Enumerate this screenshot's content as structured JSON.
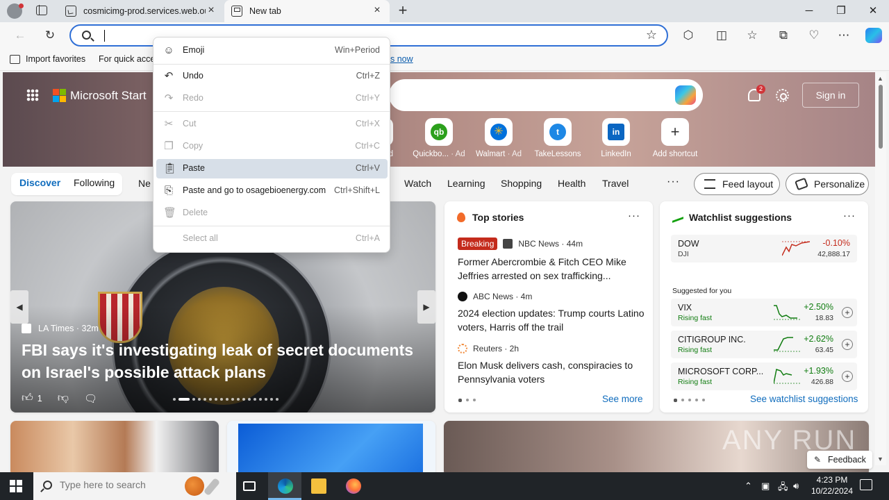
{
  "browser": {
    "tabs": [
      {
        "title": "cosmicimg-prod.services.web.ou",
        "active": false
      },
      {
        "title": "New tab",
        "active": true
      }
    ],
    "address_value": "",
    "favorites_bar": {
      "import": "Import favorites",
      "partial_text": "For quick acce",
      "link_partial": "s now"
    }
  },
  "context_menu": {
    "items": [
      {
        "label": "Emoji",
        "shortcut": "Win+Period",
        "enabled": true,
        "icon": "emoji-icon"
      },
      {
        "label": "Undo",
        "shortcut": "Ctrl+Z",
        "enabled": true,
        "icon": "undo-icon"
      },
      {
        "label": "Redo",
        "shortcut": "Ctrl+Y",
        "enabled": false,
        "icon": "redo-icon"
      },
      {
        "label": "Cut",
        "shortcut": "Ctrl+X",
        "enabled": false,
        "icon": "cut-icon"
      },
      {
        "label": "Copy",
        "shortcut": "Ctrl+C",
        "enabled": false,
        "icon": "copy-icon"
      },
      {
        "label": "Paste",
        "shortcut": "Ctrl+V",
        "enabled": true,
        "highlighted": true,
        "icon": "paste-icon"
      },
      {
        "label": "Paste and go to osagebioenergy.com",
        "shortcut": "Ctrl+Shift+L",
        "enabled": true,
        "icon": "paste-go-icon"
      },
      {
        "label": "Delete",
        "shortcut": "",
        "enabled": false,
        "icon": "delete-icon"
      },
      {
        "label": "Select all",
        "shortcut": "Ctrl+A",
        "enabled": false,
        "icon": ""
      }
    ]
  },
  "start_page": {
    "brand": "Microsoft Start",
    "notification_count": "2",
    "signin": "Sign in",
    "shortcuts": [
      {
        "label": "Quickbo...",
        "ad": "· Ad",
        "color": "#2ca01c",
        "glyph": "qb"
      },
      {
        "label": "Walmart",
        "ad": "· Ad",
        "color": "#0071dc",
        "glyph": "✳"
      },
      {
        "label": "TakeLessons",
        "ad": "",
        "color": "#1e88e5",
        "glyph": "t"
      },
      {
        "label": "LinkedIn",
        "ad": "",
        "color": "#0a66c2",
        "glyph": "in"
      },
      {
        "label": "Add shortcut",
        "ad": "",
        "color": "",
        "glyph": "+"
      }
    ],
    "shortcut_partial_ad": "d",
    "nav": {
      "discover": "Discover",
      "following": "Following",
      "partial": "Ne",
      "links": [
        "Watch",
        "Learning",
        "Shopping",
        "Health",
        "Travel"
      ],
      "more": "···",
      "feed_layout": "Feed layout",
      "personalize": "Personalize"
    },
    "hero": {
      "source": "LA Times · 32m",
      "title": "FBI says it's investigating leak of secret documents on Israel's possible attack plans",
      "likes": "1"
    },
    "top_stories": {
      "heading": "Top stories",
      "stories": [
        {
          "badge": "Breaking",
          "source": "NBC News · 44m",
          "title": "Former Abercrombie & Fitch CEO Mike Jeffries arrested on sex trafficking..."
        },
        {
          "badge": "",
          "source": "ABC News · 4m",
          "title": "2024 election updates: Trump courts Latino voters, Harris off the trail"
        },
        {
          "badge": "",
          "source": "Reuters · 2h",
          "title": "Elon Musk delivers cash, conspiracies to Pennsylvania voters"
        }
      ],
      "see_more": "See more"
    },
    "watchlist": {
      "heading": "Watchlist suggestions",
      "dow": {
        "symbol": "DOW",
        "sub": "DJI",
        "change": "-0.10%",
        "price": "42,888.17"
      },
      "suggested_label": "Suggested for you",
      "suggested": [
        {
          "symbol": "VIX",
          "sub": "Rising fast",
          "change": "+2.50%",
          "price": "18.83"
        },
        {
          "symbol": "CITIGROUP INC.",
          "sub": "Rising fast",
          "change": "+2.62%",
          "price": "63.45"
        },
        {
          "symbol": "MICROSOFT CORP...",
          "sub": "Rising fast",
          "change": "+1.93%",
          "price": "426.88"
        }
      ],
      "see_all": "See watchlist suggestions"
    },
    "feedback": "Feedback",
    "watermark": "ANY RUN"
  },
  "taskbar": {
    "search_placeholder": "Type here to search",
    "time": "4:23 PM",
    "date": "10/22/2024"
  },
  "colors": {
    "accent": "#0f6cbd",
    "negative": "#c42b1c",
    "positive": "#107c10",
    "highlight": "#d7dfe8"
  }
}
